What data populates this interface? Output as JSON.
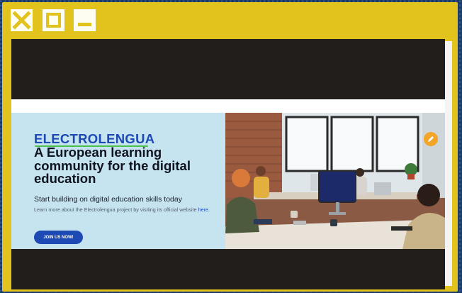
{
  "window_controls": {
    "close_icon": "close-x-icon",
    "maximize_icon": "maximize-square-icon",
    "minimize_icon": "minimize-bar-icon"
  },
  "hero": {
    "brand": "ELECTROLENGUA",
    "title": "A European learning community for the digital education",
    "subtitle": "Start building on digital education skills today",
    "description": "Learn more about the Electrolengua project by visiting its official website",
    "link_text": "here.",
    "cta_label": "JOIN US NOW!"
  },
  "colors": {
    "window_frame": "#e2c21c",
    "brand_blue": "#1c49b4",
    "hero_bg": "#c6e3f0",
    "underline_green": "#4cc04c",
    "fab_orange": "#f3a52a"
  },
  "icons": {
    "fab": "pencil-icon"
  }
}
